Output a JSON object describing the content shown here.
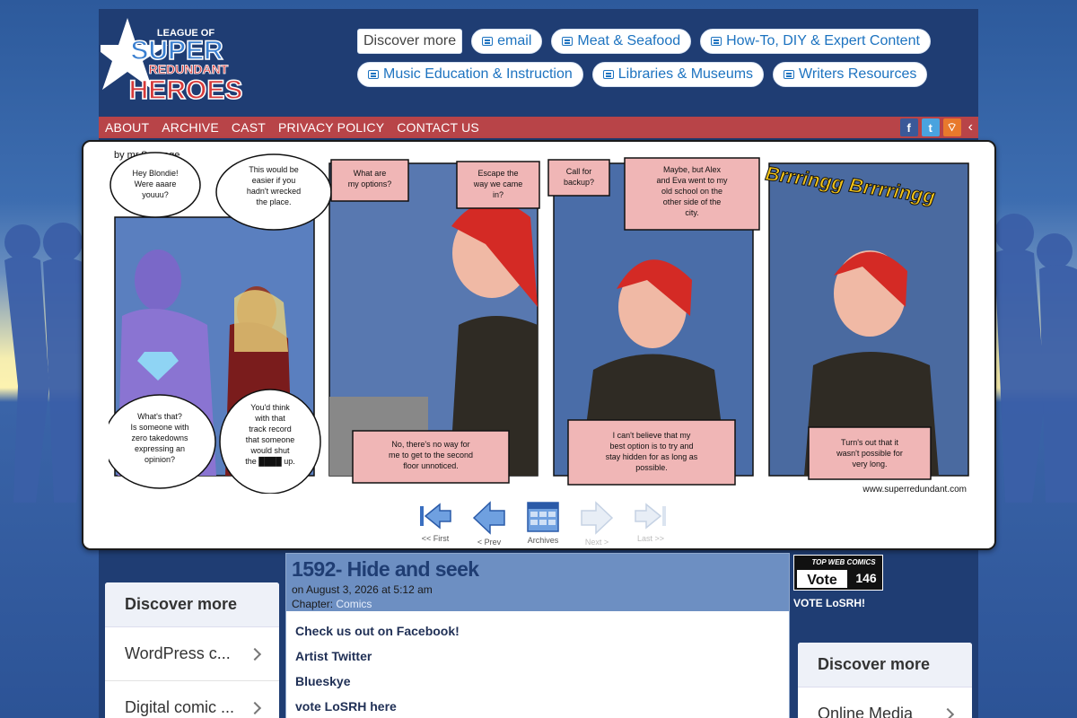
{
  "header": {
    "logo_line1": "LEAGUE OF",
    "logo_line2": "SUPER",
    "logo_line3": "REDUNDANT",
    "logo_line4": "HEROES",
    "discover_label": "Discover more",
    "tags_row1": [
      "email",
      "Meat & Seafood",
      "How-To, DIY & Expert Content"
    ],
    "tags_row2": [
      "Music Education & Instruction",
      "Libraries & Museums",
      "Writers Resources"
    ]
  },
  "nav": {
    "items": [
      "ABOUT",
      "ARCHIVE",
      "CAST",
      "PRIVACY POLICY",
      "CONTACT US"
    ],
    "social": [
      {
        "name": "facebook-icon",
        "glyph": "f",
        "color": "#3b5998"
      },
      {
        "name": "twitter-icon",
        "glyph": "t",
        "color": "#4aa3df"
      },
      {
        "name": "rss-icon",
        "glyph": "⌔",
        "color": "#e8792c"
      }
    ],
    "collapse": "‹"
  },
  "comic": {
    "byline": "by mr.Sausage",
    "sfx": "Brrringg Brrrringg",
    "url": "www.superredundant.com",
    "p1_top_left": [
      "Hey Blondie!",
      "Were aaare",
      "youuu?"
    ],
    "p1_top_right": [
      "This would be",
      "easier if you",
      "hadn't wrecked",
      "the place."
    ],
    "p1_bot_left": [
      "What's that?",
      "Is someone with",
      "zero takedowns",
      "expressing an",
      "opinion?"
    ],
    "p1_bot_right": [
      "You'd think",
      "with that",
      "track record",
      "that someone",
      "would shut",
      "the ████ up."
    ],
    "p2_top_left": [
      "What are",
      "my options?"
    ],
    "p2_top_right": [
      "Escape the",
      "way we came",
      "in?"
    ],
    "p2_bottom": [
      "No, there's no way for",
      "me to get to the second",
      "floor unnoticed."
    ],
    "p3_top_left": [
      "Call for",
      "backup?"
    ],
    "p3_top_right": [
      "Maybe, but Alex",
      "and Eva went to my",
      "old school on the",
      "other side of the",
      "city."
    ],
    "p3_bottom": [
      "I can't believe that my",
      "best option is to try and",
      "stay hidden for as long as",
      "possible."
    ],
    "p4_bottom": [
      "Turn's out that it",
      "wasn't possible for",
      "very long."
    ]
  },
  "comic_nav": [
    {
      "label": "<< First",
      "enabled": true
    },
    {
      "label": "< Prev",
      "enabled": true
    },
    {
      "label": "Archives",
      "enabled": true
    },
    {
      "label": "Next >",
      "enabled": false
    },
    {
      "label": "Last >>",
      "enabled": false
    }
  ],
  "left_sidebar": {
    "title": "Discover more",
    "items": [
      "WordPress c...",
      "Digital comic ..."
    ]
  },
  "post": {
    "title": "1592- Hide and seek",
    "date_line": "on August 3, 2026 at 5:12 am",
    "chapter_label": "Chapter:",
    "chapter_link": "Comics",
    "links": [
      "Check us out on Facebook!",
      "Artist Twitter",
      "Blueskye",
      "vote LoSRH here"
    ]
  },
  "vote": {
    "badge_top": "TOP WEB COMICS",
    "badge_vote": "Vote",
    "badge_count": "146",
    "caption": "VOTE LoSRH!"
  },
  "right_sidebar": {
    "title": "Discover more",
    "items": [
      "Online Media"
    ]
  }
}
